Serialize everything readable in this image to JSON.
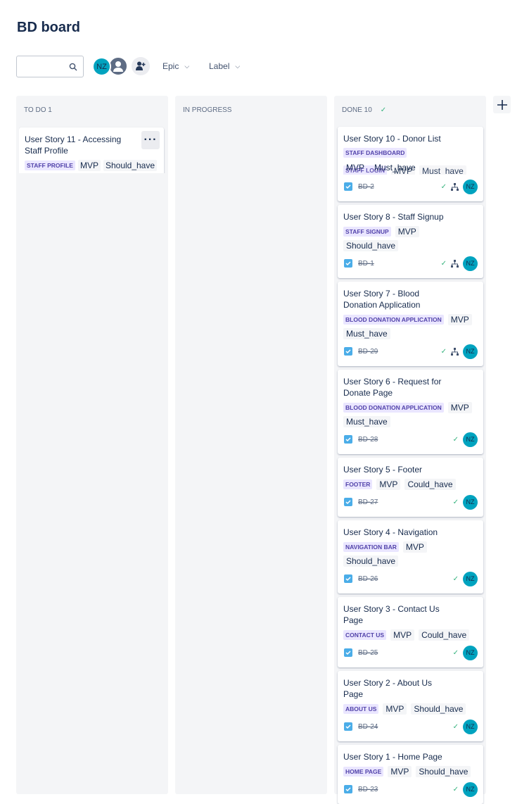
{
  "title": "BD board",
  "search": {
    "placeholder": ""
  },
  "avatars": [
    {
      "initials": "NZ"
    },
    {
      "initials": ""
    }
  ],
  "filters": {
    "epic": "Epic",
    "label": "Label"
  },
  "columns": {
    "todo": {
      "title": "TO DO 1",
      "cards": [
        {
          "title": "User Story 11 - Accessing Staff Profile",
          "epic": "STAFF PROFILE",
          "labels": [
            "MVP",
            "Should_have"
          ]
        }
      ]
    },
    "inprogress": {
      "title": "IN PROGRESS"
    },
    "done": {
      "title": "DONE 10",
      "cards": [
        {
          "title": "User Story 10 - Donor List",
          "epic": "STAFF DASHBOARD",
          "labels": [
            "MVP",
            "Must_have"
          ],
          "ghost": {
            "epic": "STAFF LOGIN",
            "labels": [
              "MVP",
              "Must_have"
            ]
          },
          "key": "BD-2",
          "subtasks": true,
          "assignee": "NZ"
        },
        {
          "title": "User Story 8 - Staff Signup",
          "epic": "STAFF SIGNUP",
          "labels": [
            "MVP",
            "Should_have"
          ],
          "key": "BD-1",
          "subtasks": true,
          "assignee": "NZ"
        },
        {
          "title": "User Story 7 - Blood Donation Application",
          "epic": "BLOOD DONATION APPLICATION",
          "labels": [
            "MVP",
            "Must_have"
          ],
          "key": "BD-29",
          "subtasks": true,
          "assignee": "NZ"
        },
        {
          "title": "User Story 6 - Request for Donate Page",
          "epic": "BLOOD DONATION APPLICATION",
          "labels": [
            "MVP",
            "Must_have"
          ],
          "key": "BD-28",
          "assignee": "NZ"
        },
        {
          "title": "User Story 5 - Footer",
          "epic": "FOOTER",
          "labels": [
            "MVP",
            "Could_have"
          ],
          "key": "BD-27",
          "assignee": "NZ"
        },
        {
          "title": "User Story 4 - Navigation",
          "epic": "NAVIGATION BAR",
          "labels": [
            "MVP",
            "Should_have"
          ],
          "key": "BD-26",
          "assignee": "NZ"
        },
        {
          "title": "User Story 3 - Contact Us Page",
          "epic": "CONTACT US",
          "labels": [
            "MVP",
            "Could_have"
          ],
          "key": "BD-25",
          "assignee": "NZ"
        },
        {
          "title": "User Story 2 - About Us Page",
          "epic": "ABOUT US",
          "labels": [
            "MVP",
            "Should_have"
          ],
          "key": "BD-24",
          "assignee": "NZ"
        },
        {
          "title": "User Story 1 - Home Page",
          "epic": "HOME PAGE",
          "labels": [
            "MVP",
            "Should_have"
          ],
          "key": "BD-23",
          "assignee": "NZ"
        }
      ]
    }
  },
  "colors": {
    "avatar": "#00a3bf",
    "epic_bg": "#eae6ff",
    "epic_text": "#5243aa",
    "done_check": "#36b37e",
    "checkbox": "#4bade8"
  }
}
